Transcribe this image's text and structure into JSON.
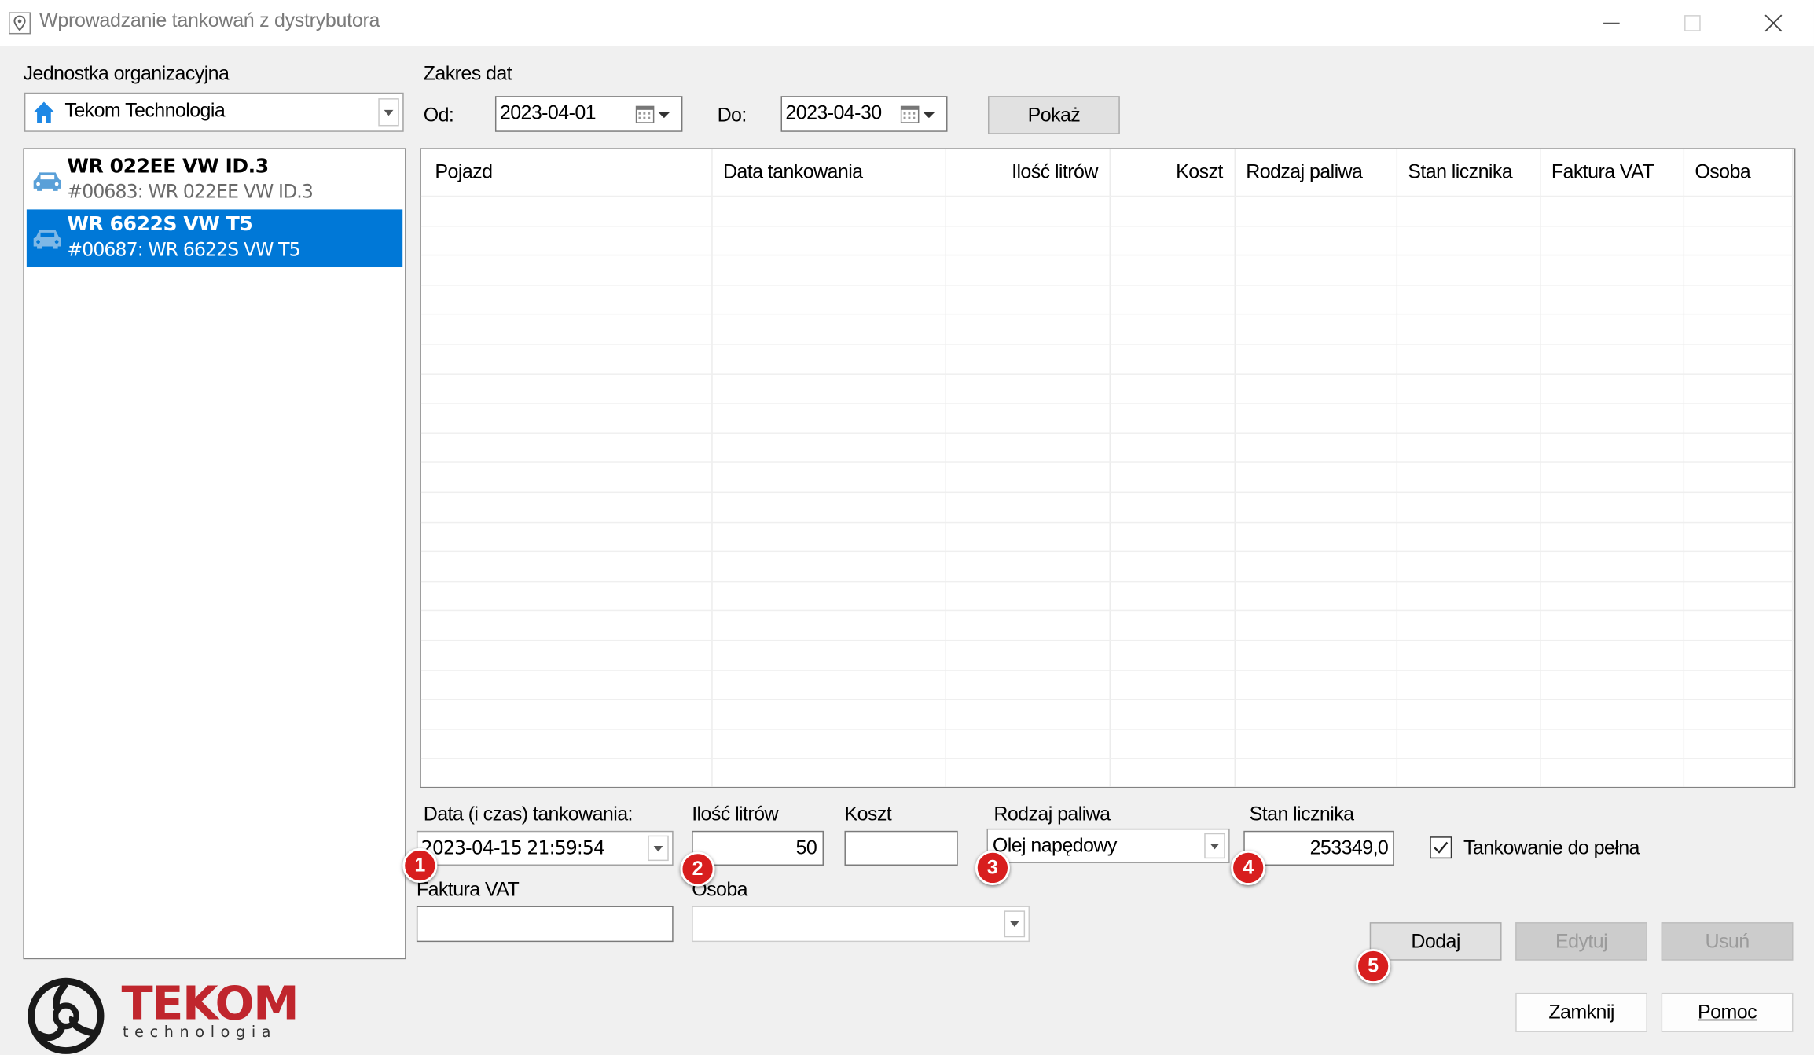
{
  "window": {
    "title": "Wprowadzanie tankowań z dystrybutora"
  },
  "org_unit": {
    "label": "Jednostka organizacyjna",
    "selected": "Tekom Technologia"
  },
  "date_range": {
    "label": "Zakres dat",
    "from_label": "Od:",
    "from_value": "2023-04-01",
    "to_label": "Do:",
    "to_value": "2023-04-30",
    "show_button": "Pokaż"
  },
  "vehicles": [
    {
      "title": "WR 022EE VW ID.3",
      "subtitle": "#00683: WR 022EE VW ID.3",
      "selected": false
    },
    {
      "title": "WR 6622S VW T5",
      "subtitle": "#00687: WR 6622S VW T5",
      "selected": true
    }
  ],
  "grid": {
    "columns": [
      "Pojazd",
      "Data tankowania",
      "Ilość litrów",
      "Koszt",
      "Rodzaj paliwa",
      "Stan licznika",
      "Faktura VAT",
      "Osoba"
    ],
    "rows": []
  },
  "form": {
    "datetime_label": "Data (i czas) tankowania:",
    "datetime_value": "2023-04-15 21:59:54",
    "liters_label": "Ilość litrów",
    "liters_value": "50",
    "cost_label": "Koszt",
    "cost_value": "",
    "fuel_label": "Rodzaj paliwa",
    "fuel_value": "Olej napędowy",
    "odometer_label": "Stan licznika",
    "odometer_value": "253349,0",
    "full_tank_label": "Tankowanie do pełna",
    "full_tank_checked": true,
    "invoice_label": "Faktura VAT",
    "invoice_value": "",
    "person_label": "Osoba",
    "person_value": ""
  },
  "actions": {
    "add": "Dodaj",
    "edit": "Edytuj",
    "delete": "Usuń",
    "close": "Zamknij",
    "help": "Pomoc"
  },
  "badges": [
    "1",
    "2",
    "3",
    "4",
    "5"
  ],
  "logo": {
    "name": "TEKOM",
    "tagline": "technologia"
  },
  "colors": {
    "selection": "#0078d7",
    "badge": "#d81e1e",
    "logo_red": "#c0262d",
    "home_icon": "#1e88e5"
  }
}
